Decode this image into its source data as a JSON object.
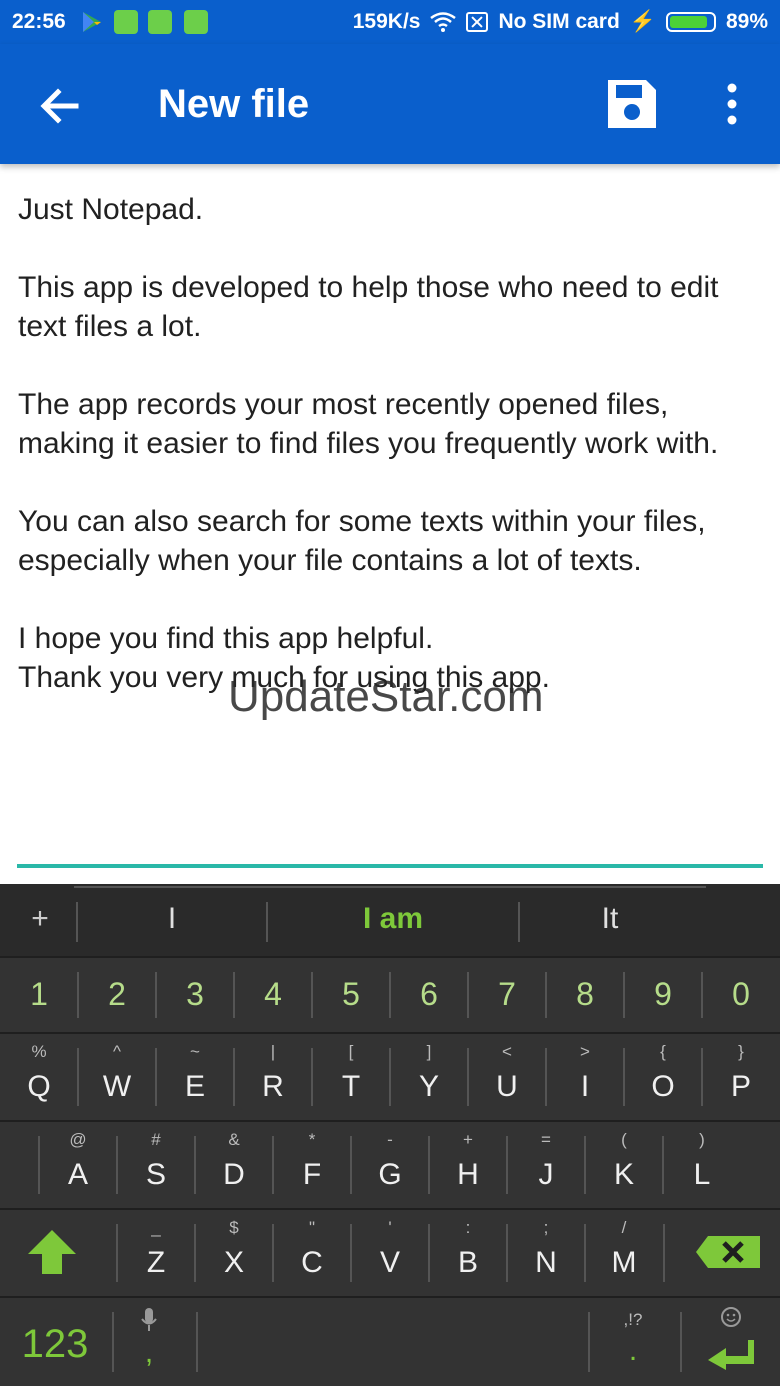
{
  "status_bar": {
    "time": "22:56",
    "net_speed": "159K/s",
    "sim": "No SIM card",
    "battery": "89%",
    "battery_level": 0.89
  },
  "app_bar": {
    "title": "New file",
    "back_icon": "arrow-left-icon",
    "save_icon": "floppy-disk-icon",
    "menu_icon": "more-vert-icon"
  },
  "editor": {
    "text": "Just Notepad.\n\nThis app is developed to help those who need to edit text files a lot.\n\nThe app records your most recently opened files, making it easier to find files you frequently work with.\n\nYou can also search for some texts within your files, especially when your file contains a lot of texts.\n\nI hope you find this app helpful.\nThank you very much for using this app."
  },
  "watermark": "UpdateStar.com",
  "keyboard": {
    "suggestions": {
      "plus": "+",
      "left": "I",
      "center": "I am",
      "right": "It"
    },
    "number_row": [
      "1",
      "2",
      "3",
      "4",
      "5",
      "6",
      "7",
      "8",
      "9",
      "0"
    ],
    "row1": [
      {
        "main": "Q",
        "sub": "%"
      },
      {
        "main": "W",
        "sub": "^"
      },
      {
        "main": "E",
        "sub": "~"
      },
      {
        "main": "R",
        "sub": "|"
      },
      {
        "main": "T",
        "sub": "["
      },
      {
        "main": "Y",
        "sub": "]"
      },
      {
        "main": "U",
        "sub": "<"
      },
      {
        "main": "I",
        "sub": ">"
      },
      {
        "main": "O",
        "sub": "{"
      },
      {
        "main": "P",
        "sub": "}"
      }
    ],
    "row2": [
      {
        "main": "A",
        "sub": "@"
      },
      {
        "main": "S",
        "sub": "#"
      },
      {
        "main": "D",
        "sub": "&"
      },
      {
        "main": "F",
        "sub": "*"
      },
      {
        "main": "G",
        "sub": "-"
      },
      {
        "main": "H",
        "sub": "+"
      },
      {
        "main": "J",
        "sub": "="
      },
      {
        "main": "K",
        "sub": "("
      },
      {
        "main": "L",
        "sub": ")"
      }
    ],
    "row3": [
      {
        "main": "Z",
        "sub": "_"
      },
      {
        "main": "X",
        "sub": "$"
      },
      {
        "main": "C",
        "sub": "\""
      },
      {
        "main": "V",
        "sub": "'"
      },
      {
        "main": "B",
        "sub": ":"
      },
      {
        "main": "N",
        "sub": ";"
      },
      {
        "main": "M",
        "sub": "/"
      }
    ],
    "bottom": {
      "symbols_label": "123",
      "comma": ",",
      "punct_hint": ",!?",
      "period": "."
    },
    "accent_color": "#7ec83a"
  }
}
